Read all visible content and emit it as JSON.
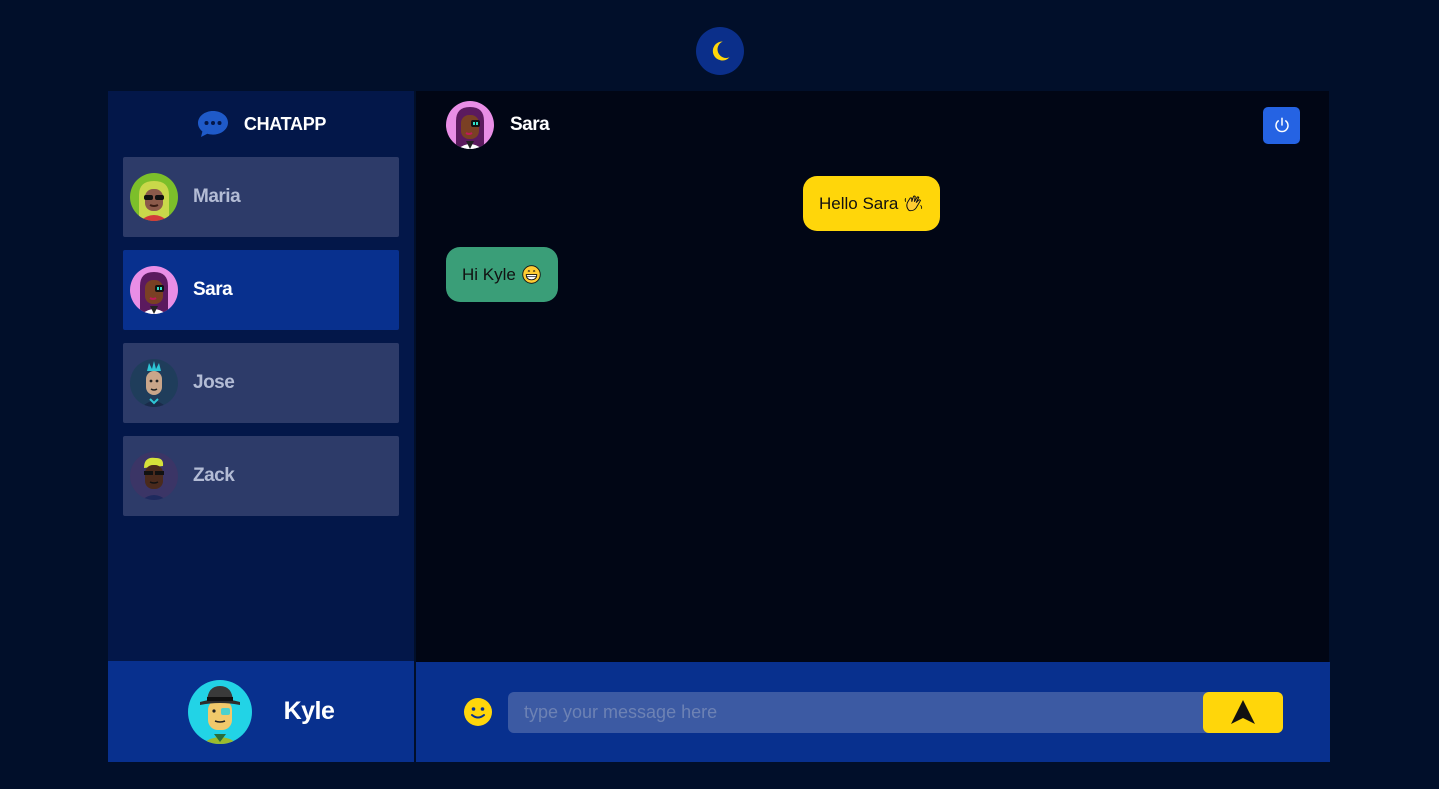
{
  "app": {
    "name": "CHATAPP"
  },
  "theme_toggle": {
    "icon": "moon-icon"
  },
  "contacts": [
    {
      "name": "Maria",
      "active": false
    },
    {
      "name": "Sara",
      "active": true
    },
    {
      "name": "Jose",
      "active": false
    },
    {
      "name": "Zack",
      "active": false
    }
  ],
  "current_user": {
    "name": "Kyle"
  },
  "chat": {
    "contact_name": "Sara",
    "messages": [
      {
        "direction": "sent",
        "text": "Hello Sara",
        "emoji": "waving-hand"
      },
      {
        "direction": "received",
        "text": "Hi Kyle",
        "emoji": "grinning-face"
      }
    ]
  },
  "composer": {
    "placeholder": "type your message here",
    "value": ""
  },
  "colors": {
    "page_bg": "#010f2a",
    "sidebar_bg": "#031749",
    "active_contact": "#08308e",
    "contact_bg": "#2d3b69",
    "sent_bubble": "#ffd60a",
    "received_bubble": "#3a9e78",
    "logout_button": "#2563e3"
  }
}
